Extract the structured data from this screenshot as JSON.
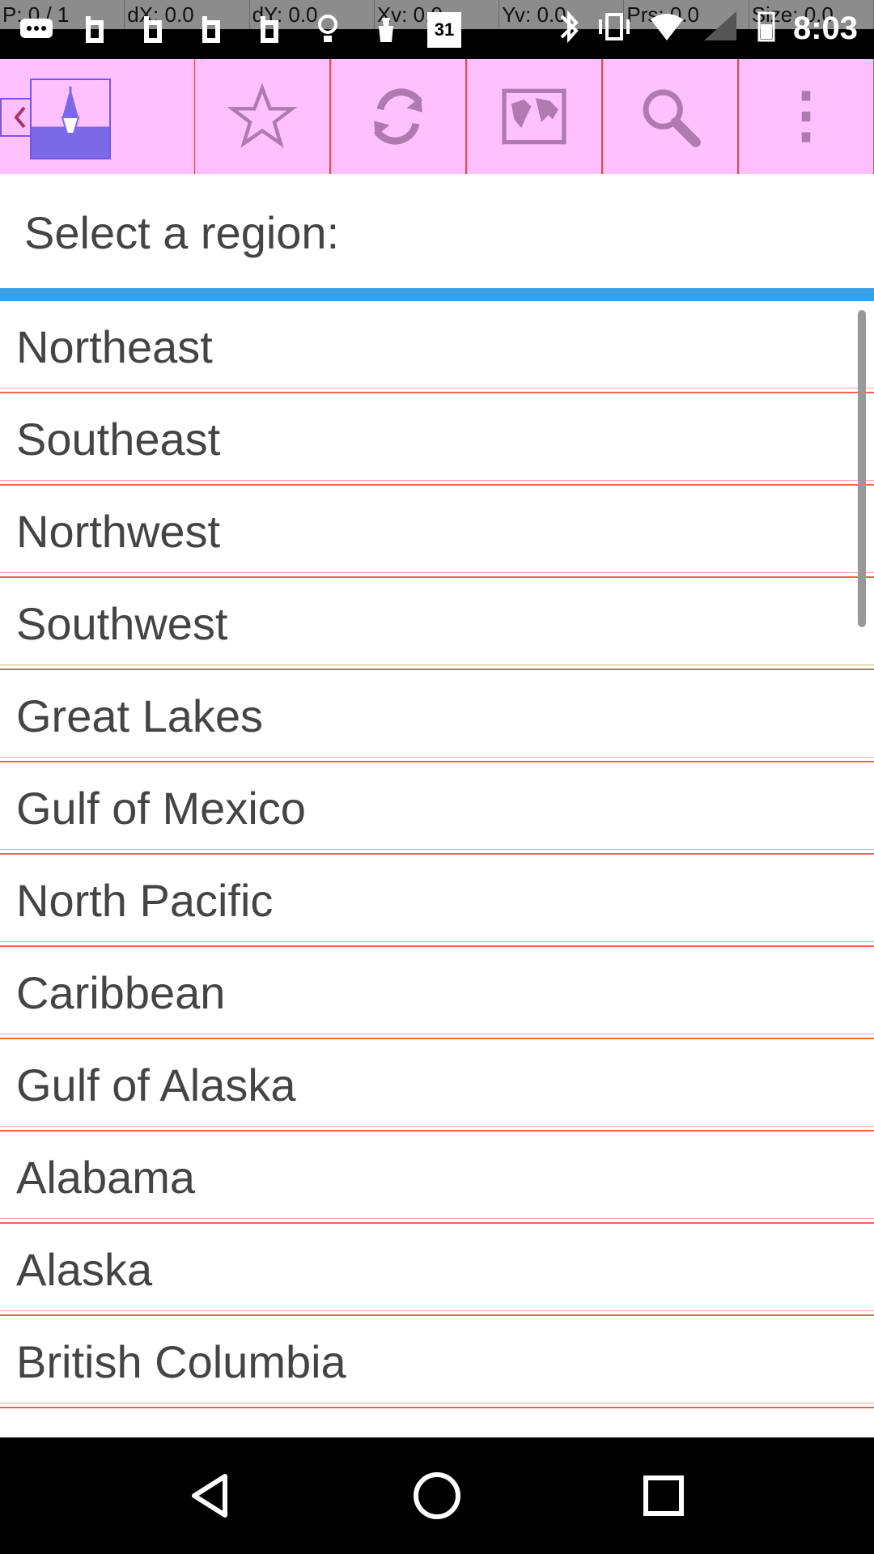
{
  "debug": {
    "p": "P: 0 / 1",
    "dx": "dX: 0.0",
    "dy": "dY: 0.0",
    "xv": "Xv: 0.0",
    "yv": "Yv: 0.0",
    "prs": "Prs: 0.0",
    "size": "Size: 0.0"
  },
  "status": {
    "calendar_day": "31",
    "time": "8:03"
  },
  "header": {
    "title": "Select a region:"
  },
  "regions": [
    "Northeast",
    "Southeast",
    "Northwest",
    "Southwest",
    "Great Lakes",
    "Gulf of Mexico",
    "North Pacific",
    "Caribbean",
    "Gulf of Alaska",
    "Alabama",
    "Alaska",
    "British Columbia"
  ],
  "icons": {
    "toolbar": [
      "back-icon",
      "buoy-logo-icon",
      "star-icon",
      "refresh-icon",
      "world-map-icon",
      "search-icon",
      "overflow-menu-icon"
    ],
    "nav": [
      "back-triangle-icon",
      "home-circle-icon",
      "recents-square-icon"
    ]
  }
}
